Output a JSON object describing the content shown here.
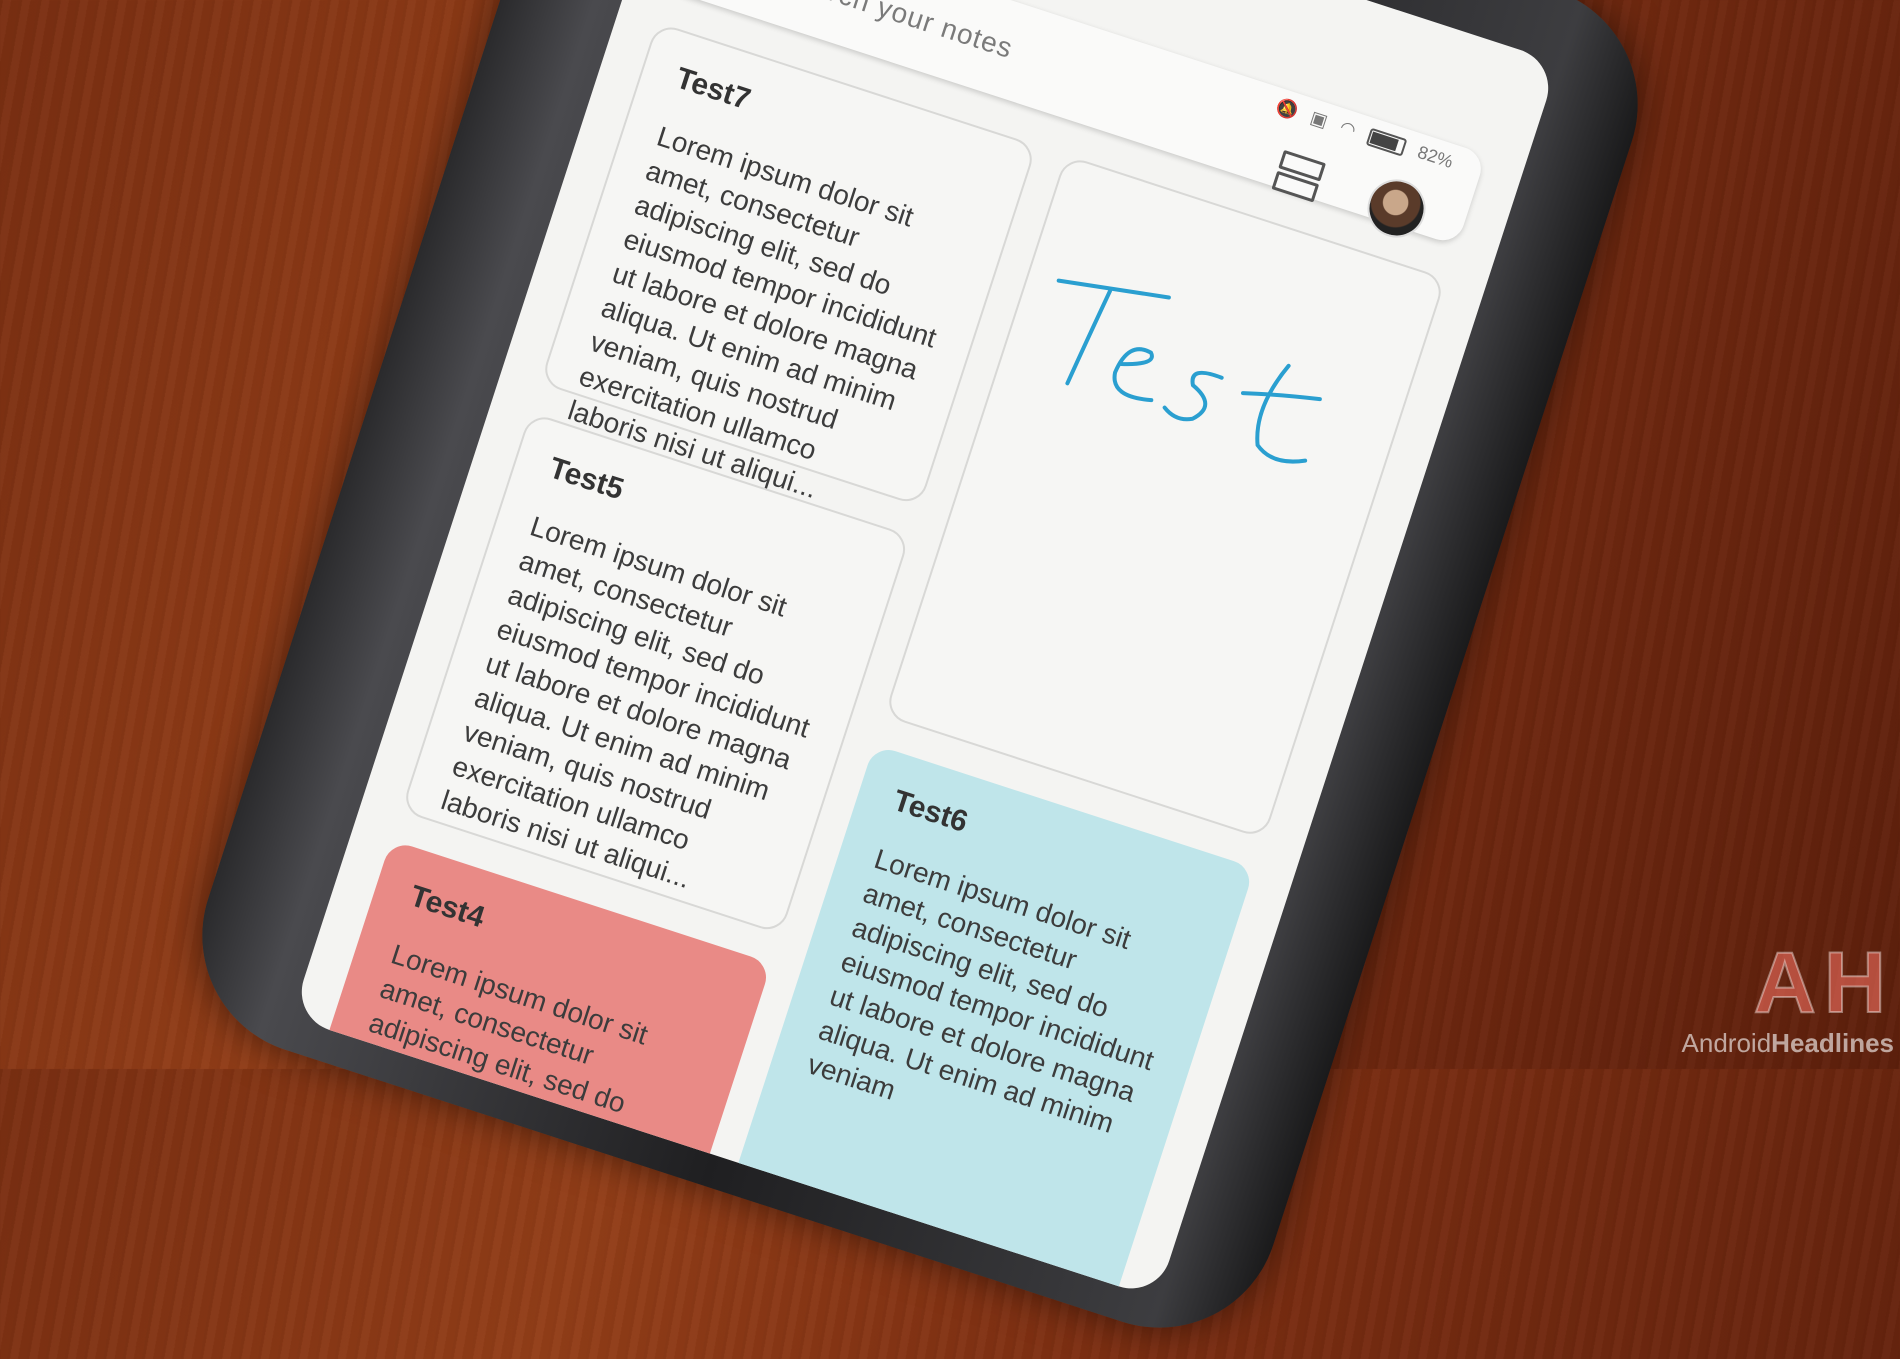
{
  "search": {
    "placeholder": "Search your notes"
  },
  "status": {
    "battery": "82%"
  },
  "notes": {
    "test7": {
      "title": "Test7",
      "body": "Lorem ipsum dolor sit amet, consectetur adipiscing elit, sed do eiusmod tempor incididunt ut labore et dolore magna aliqua. Ut enim ad minim veniam, quis nostrud exercitation ullamco laboris nisi ut aliqui..."
    },
    "test5": {
      "title": "Test5",
      "body": "Lorem ipsum dolor sit amet, consectetur adipiscing elit, sed do eiusmod tempor incididunt ut labore et dolore magna aliqua. Ut enim ad minim veniam, quis nostrud exercitation ullamco laboris nisi ut aliqui..."
    },
    "test4": {
      "title": "Test4",
      "body": "Lorem ipsum dolor sit amet, consectetur adipiscing elit, sed do"
    },
    "drawing": {
      "text": "Test",
      "ink_color": "#2a9fd0"
    },
    "test6": {
      "title": "Test6",
      "body": "Lorem ipsum dolor sit amet, consectetur adipiscing elit, sed do eiusmod tempor incididunt ut labore et dolore magna aliqua. Ut enim ad minim veniam"
    }
  },
  "colors": {
    "red_note": "#e98a86",
    "blue_note": "#bfe5ea",
    "wood": "#7a2f12"
  },
  "watermark": {
    "logo": "AH",
    "text_a": "Android",
    "text_b": "Headlines"
  }
}
